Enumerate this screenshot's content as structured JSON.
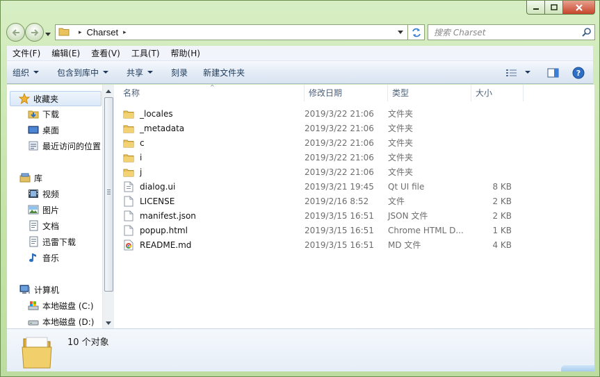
{
  "window": {
    "caption_buttons": [
      "minimize",
      "maximize",
      "close"
    ]
  },
  "address": {
    "path": [
      "Charset"
    ],
    "separator": "▸",
    "search_placeholder": "搜索 Charset"
  },
  "menu": [
    "文件(F)",
    "编辑(E)",
    "查看(V)",
    "工具(T)",
    "帮助(H)"
  ],
  "toolbar": {
    "organize": "组织",
    "include_in_library": "包含到库中",
    "share": "共享",
    "burn": "刻录",
    "new_folder": "新建文件夹"
  },
  "nav": {
    "favorites": "收藏夹",
    "favorites_items": [
      "下载",
      "桌面",
      "最近访问的位置"
    ],
    "libraries": "库",
    "library_items": [
      "视频",
      "图片",
      "文档",
      "迅雷下载",
      "音乐"
    ],
    "computer": "计算机",
    "computer_items": [
      "本地磁盘 (C:)",
      "本地磁盘 (D:)"
    ]
  },
  "columns": {
    "name": "名称",
    "date": "修改日期",
    "type": "类型",
    "size": "大小"
  },
  "files": [
    {
      "name": "_locales",
      "date": "2019/3/22 21:06",
      "type": "文件夹",
      "size": "",
      "icon": "folder-icon"
    },
    {
      "name": "_metadata",
      "date": "2019/3/22 21:06",
      "type": "文件夹",
      "size": "",
      "icon": "folder-icon"
    },
    {
      "name": "c",
      "date": "2019/3/22 21:06",
      "type": "文件夹",
      "size": "",
      "icon": "folder-icon"
    },
    {
      "name": "i",
      "date": "2019/3/22 21:06",
      "type": "文件夹",
      "size": "",
      "icon": "folder-icon"
    },
    {
      "name": "j",
      "date": "2019/3/22 21:06",
      "type": "文件夹",
      "size": "",
      "icon": "folder-icon"
    },
    {
      "name": "dialog.ui",
      "date": "2019/3/21 19:45",
      "type": "Qt UI file",
      "size": "8 KB",
      "icon": "ui-file-icon"
    },
    {
      "name": "LICENSE",
      "date": "2019/2/16 8:52",
      "type": "文件",
      "size": "2 KB",
      "icon": "blank-file-icon"
    },
    {
      "name": "manifest.json",
      "date": "2019/3/15 16:51",
      "type": "JSON 文件",
      "size": "2 KB",
      "icon": "blank-file-icon"
    },
    {
      "name": "popup.html",
      "date": "2019/3/15 16:51",
      "type": "Chrome HTML D...",
      "size": "1 KB",
      "icon": "blank-file-icon"
    },
    {
      "name": "README.md",
      "date": "2019/3/15 16:51",
      "type": "MD 文件",
      "size": "4 KB",
      "icon": "chrome-file-icon"
    }
  ],
  "details": {
    "item_count": "10 个对象"
  }
}
